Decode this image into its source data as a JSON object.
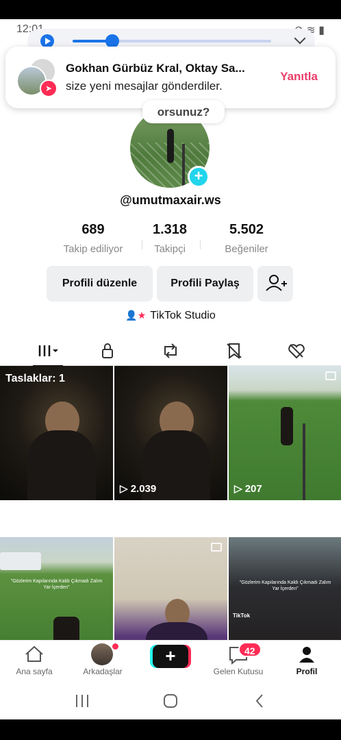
{
  "statusbar": {
    "time": "12:01",
    "icons": "⊘ ≋ ▮"
  },
  "media_player": {
    "progress": 0.2
  },
  "notification": {
    "title": "Gokhan Gürbüz Kral, Oktay Sa...",
    "body": "size yeni mesajlar gönderdiler.",
    "reply_label": "Yanıtla"
  },
  "profile": {
    "bubble_text": "orsunuz?",
    "username": "@umutmaxair.ws",
    "stats": [
      {
        "value": "689",
        "label": "Takip ediliyor"
      },
      {
        "value": "1.318",
        "label": "Takipçi"
      },
      {
        "value": "5.502",
        "label": "Beğeniler"
      }
    ],
    "edit_label": "Profili düzenle",
    "share_label": "Profili Paylaş",
    "studio_label": "TikTok Studio"
  },
  "grid": {
    "drafts_label": "Taslaklar: 1",
    "views": [
      "2.039",
      "207"
    ],
    "captions": [
      "\"Gözlerim Kapılarında Kaldı Çıkmadı Zalım Yar İçerden\"",
      "TikTok"
    ]
  },
  "bottom_nav": {
    "home": "Ana sayfa",
    "friends": "Arkadaşlar",
    "inbox": "Gelen Kutusu",
    "inbox_count": "42",
    "profile": "Profil"
  },
  "colors": {
    "accent": "#fe2c55",
    "cyan": "#25f4ee",
    "reply": "#ea3d6a"
  }
}
